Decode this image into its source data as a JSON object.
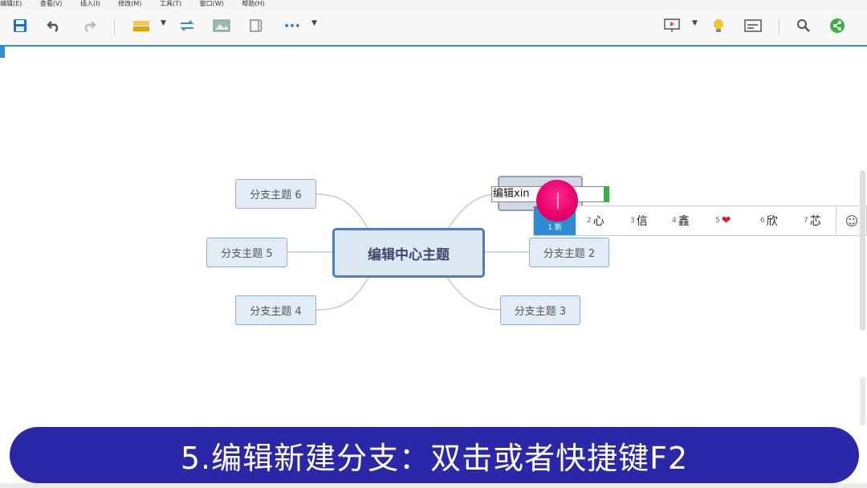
{
  "menubar": {
    "items": [
      "编辑(E)",
      "查看(V)",
      "插入(I)",
      "修改(M)",
      "工具(T)",
      "窗口(W)",
      "帮助(H)"
    ]
  },
  "toolbar": {
    "icons": [
      "save-icon",
      "undo-icon",
      "redo-icon",
      "topic-style-icon",
      "relationship-icon",
      "image-icon",
      "boundary-icon",
      "more-icon",
      "presentation-icon",
      "idea-icon",
      "outline-icon",
      "search-icon",
      "share-icon"
    ],
    "more_label": "···"
  },
  "mindmap": {
    "central": "编辑中心主题",
    "branches": [
      "分支主题 6",
      "分支主题 5",
      "分支主题 4",
      "分支主题 2",
      "分支主题 3"
    ]
  },
  "edit": {
    "value": "编辑xin"
  },
  "ime": {
    "first": "1 新",
    "candidates": [
      {
        "n": "2",
        "c": "心"
      },
      {
        "n": "3",
        "c": "信"
      },
      {
        "n": "4",
        "c": "鑫"
      },
      {
        "n": "5",
        "c": "❤"
      },
      {
        "n": "6",
        "c": "欣"
      },
      {
        "n": "7",
        "c": "芯"
      }
    ],
    "emoji": "☺"
  },
  "caption": "5.编辑新建分支：双击或者快捷键F2",
  "colors": {
    "accent": "#2c8fd6",
    "caption_bg": "#2a27a8",
    "node_border": "#8fb0cf",
    "node_bg": "#e3ecf6",
    "central_border": "#4f7fb6",
    "pointer": "#e6006b"
  }
}
